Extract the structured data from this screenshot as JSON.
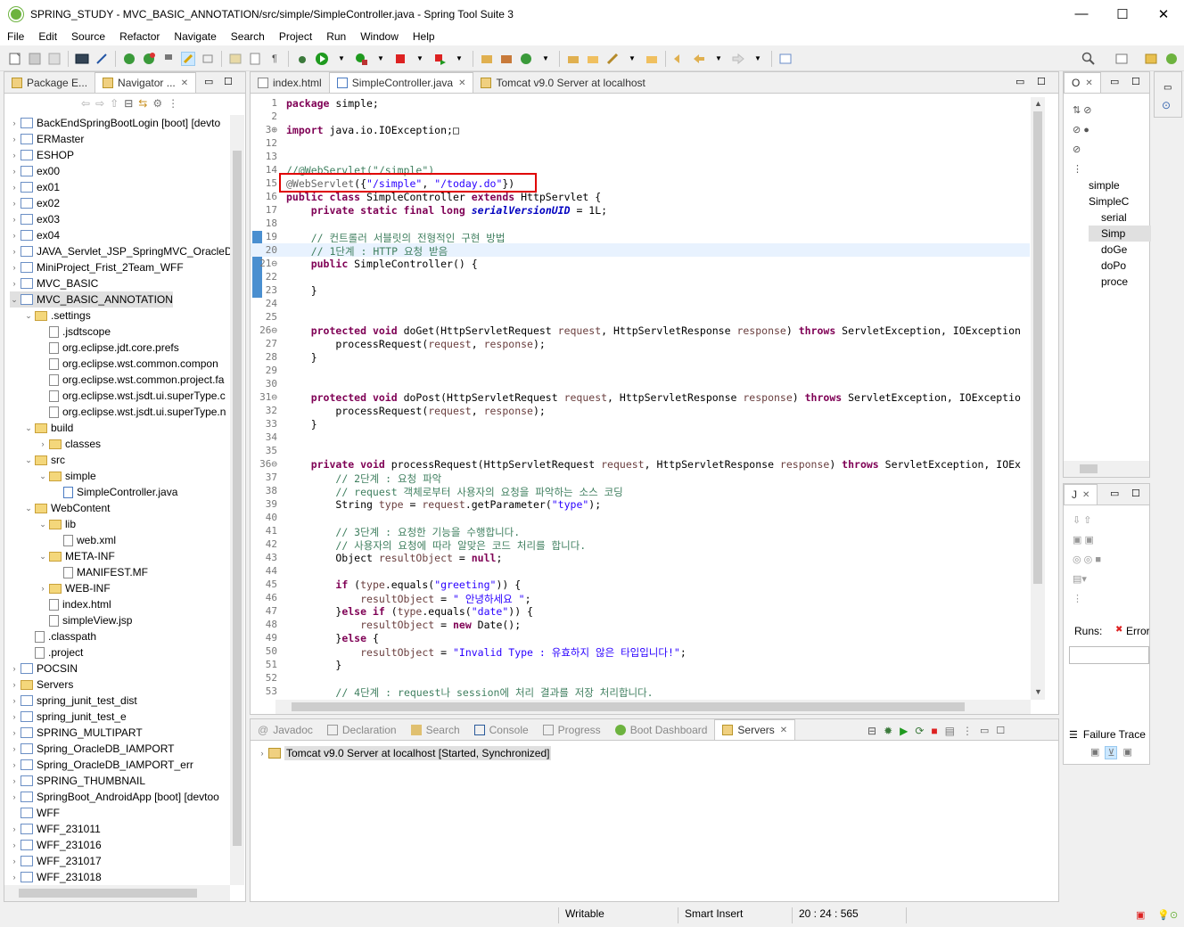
{
  "window": {
    "title": "SPRING_STUDY - MVC_BASIC_ANNOTATION/src/simple/SimpleController.java - Spring Tool Suite 3",
    "minimize": "—",
    "maximize": "☐",
    "close": "✕"
  },
  "menu": [
    "File",
    "Edit",
    "Source",
    "Refactor",
    "Navigate",
    "Search",
    "Project",
    "Run",
    "Window",
    "Help"
  ],
  "explorer": {
    "tabs": [
      "Package E...",
      "Navigator ..."
    ],
    "items": [
      {
        "label": "BackEndSpringBootLogin [boot] [devto",
        "type": "proj",
        "level": 0,
        "open": false
      },
      {
        "label": "ERMaster",
        "type": "proj",
        "level": 0,
        "open": false
      },
      {
        "label": "ESHOP",
        "type": "proj",
        "level": 0,
        "open": false
      },
      {
        "label": "ex00",
        "type": "proj",
        "level": 0,
        "open": false
      },
      {
        "label": "ex01",
        "type": "proj",
        "level": 0,
        "open": false
      },
      {
        "label": "ex02",
        "type": "proj",
        "level": 0,
        "open": false
      },
      {
        "label": "ex03",
        "type": "proj",
        "level": 0,
        "open": false
      },
      {
        "label": "ex04",
        "type": "proj",
        "level": 0,
        "open": false
      },
      {
        "label": "JAVA_Servlet_JSP_SpringMVC_OracleDB",
        "type": "proj",
        "level": 0,
        "open": false
      },
      {
        "label": "MiniProject_Frist_2Team_WFF",
        "type": "proj",
        "level": 0,
        "open": false
      },
      {
        "label": "MVC_BASIC",
        "type": "proj",
        "level": 0,
        "open": false
      },
      {
        "label": "MVC_BASIC_ANNOTATION",
        "type": "proj",
        "level": 0,
        "open": true,
        "selected": true
      },
      {
        "label": ".settings",
        "type": "folder",
        "level": 1,
        "open": true
      },
      {
        "label": ".jsdtscope",
        "type": "file",
        "level": 2
      },
      {
        "label": "org.eclipse.jdt.core.prefs",
        "type": "file",
        "level": 2
      },
      {
        "label": "org.eclipse.wst.common.compon",
        "type": "file",
        "level": 2
      },
      {
        "label": "org.eclipse.wst.common.project.fa",
        "type": "file",
        "level": 2
      },
      {
        "label": "org.eclipse.wst.jsdt.ui.superType.c",
        "type": "file",
        "level": 2
      },
      {
        "label": "org.eclipse.wst.jsdt.ui.superType.n",
        "type": "file",
        "level": 2
      },
      {
        "label": "build",
        "type": "folder",
        "level": 1,
        "open": true
      },
      {
        "label": "classes",
        "type": "folder",
        "level": 2,
        "open": false
      },
      {
        "label": "src",
        "type": "folder",
        "level": 1,
        "open": true
      },
      {
        "label": "simple",
        "type": "folder",
        "level": 2,
        "open": true
      },
      {
        "label": "SimpleController.java",
        "type": "java",
        "level": 3
      },
      {
        "label": "WebContent",
        "type": "folder",
        "level": 1,
        "open": true
      },
      {
        "label": "lib",
        "type": "folder",
        "level": 2,
        "open": true
      },
      {
        "label": "web.xml",
        "type": "file",
        "level": 3
      },
      {
        "label": "META-INF",
        "type": "folder",
        "level": 2,
        "open": true
      },
      {
        "label": "MANIFEST.MF",
        "type": "file",
        "level": 3
      },
      {
        "label": "WEB-INF",
        "type": "folder",
        "level": 2,
        "open": false
      },
      {
        "label": "index.html",
        "type": "file",
        "level": 2
      },
      {
        "label": "simpleView.jsp",
        "type": "file",
        "level": 2
      },
      {
        "label": ".classpath",
        "type": "file",
        "level": 1
      },
      {
        "label": ".project",
        "type": "file",
        "level": 1
      },
      {
        "label": "POCSIN",
        "type": "proj",
        "level": 0,
        "open": false
      },
      {
        "label": "Servers",
        "type": "folder",
        "level": 0,
        "open": false
      },
      {
        "label": "spring_junit_test_dist",
        "type": "proj",
        "level": 0,
        "open": false
      },
      {
        "label": "spring_junit_test_e",
        "type": "proj",
        "level": 0,
        "open": false
      },
      {
        "label": "SPRING_MULTIPART",
        "type": "proj",
        "level": 0,
        "open": false
      },
      {
        "label": "Spring_OracleDB_IAMPORT",
        "type": "proj",
        "level": 0,
        "open": false
      },
      {
        "label": "Spring_OracleDB_IAMPORT_err",
        "type": "proj",
        "level": 0,
        "open": false
      },
      {
        "label": "SPRING_THUMBNAIL",
        "type": "proj",
        "level": 0,
        "open": false
      },
      {
        "label": "SpringBoot_AndroidApp [boot] [devtoo",
        "type": "proj",
        "level": 0,
        "open": false
      },
      {
        "label": "WFF",
        "type": "proj",
        "level": 0,
        "open": null
      },
      {
        "label": "WFF_231011",
        "type": "proj",
        "level": 0,
        "open": false
      },
      {
        "label": "WFF_231016",
        "type": "proj",
        "level": 0,
        "open": false
      },
      {
        "label": "WFF_231017",
        "type": "proj",
        "level": 0,
        "open": false
      },
      {
        "label": "WFF_231018",
        "type": "proj",
        "level": 0,
        "open": false
      }
    ]
  },
  "editor": {
    "tabs": [
      "index.html",
      "SimpleController.java",
      "Tomcat v9.0 Server at localhost"
    ],
    "lines": [
      {
        "n": "1",
        "html": "<span class=\"kw\">package</span> simple;"
      },
      {
        "n": "2",
        "html": ""
      },
      {
        "n": "3⊕",
        "html": "<span class=\"kw\">import</span> java.io.IOException;□"
      },
      {
        "n": "12",
        "html": ""
      },
      {
        "n": "13",
        "html": ""
      },
      {
        "n": "14",
        "html": "<span class=\"cm\">//@WebServlet(\"/simple\")</span>"
      },
      {
        "n": "15",
        "html": "<span class=\"an\">@WebServlet</span>({<span class=\"st\">\"/simple\"</span>, <span class=\"st\">\"/today.do\"</span>})"
      },
      {
        "n": "16",
        "html": "<span class=\"kw\">public class</span> SimpleController <span class=\"kw\">extends</span> HttpServlet {"
      },
      {
        "n": "17",
        "html": "    <span class=\"kw\">private static final long</span> <span class=\"fld\">serialVersionUID</span> = 1L;"
      },
      {
        "n": "18",
        "html": ""
      },
      {
        "n": "19",
        "html": "    <span class=\"cm\">// 컨트롤러 서블릿의 전형적인 구현 방법</span>"
      },
      {
        "n": "20",
        "html": "    <span class=\"cm\">// 1단계 : HTTP 요청 받음</span>"
      },
      {
        "n": "21⊖",
        "html": "    <span class=\"kw\">public</span> SimpleController() {"
      },
      {
        "n": "22",
        "html": ""
      },
      {
        "n": "23",
        "html": "    }"
      },
      {
        "n": "24",
        "html": ""
      },
      {
        "n": "25",
        "html": ""
      },
      {
        "n": "26⊖",
        "html": "    <span class=\"kw\">protected void</span> doGet(HttpServletRequest <span class=\"pm\">request</span>, HttpServletResponse <span class=\"pm\">response</span>) <span class=\"kw\">throws</span> ServletException, IOException"
      },
      {
        "n": "27",
        "html": "        processRequest(<span class=\"pm\">request</span>, <span class=\"pm\">response</span>);"
      },
      {
        "n": "28",
        "html": "    }"
      },
      {
        "n": "29",
        "html": ""
      },
      {
        "n": "30",
        "html": ""
      },
      {
        "n": "31⊖",
        "html": "    <span class=\"kw\">protected void</span> doPost(HttpServletRequest <span class=\"pm\">request</span>, HttpServletResponse <span class=\"pm\">response</span>) <span class=\"kw\">throws</span> ServletException, IOExceptio"
      },
      {
        "n": "32",
        "html": "        processRequest(<span class=\"pm\">request</span>, <span class=\"pm\">response</span>);"
      },
      {
        "n": "33",
        "html": "    }"
      },
      {
        "n": "34",
        "html": ""
      },
      {
        "n": "35",
        "html": ""
      },
      {
        "n": "36⊖",
        "html": "    <span class=\"kw\">private void</span> processRequest(HttpServletRequest <span class=\"pm\">request</span>, HttpServletResponse <span class=\"pm\">response</span>) <span class=\"kw\">throws</span> ServletException, IOEx"
      },
      {
        "n": "37",
        "html": "        <span class=\"cm\">// 2단계 : 요청 파악</span>"
      },
      {
        "n": "38",
        "html": "        <span class=\"cm\">// request 객체로부터 사용자의 요청을 파악하는 소스 코딩</span>"
      },
      {
        "n": "39",
        "html": "        String <span class=\"pm\">type</span> = <span class=\"pm\">request</span>.getParameter(<span class=\"st\">\"type\"</span>);"
      },
      {
        "n": "40",
        "html": ""
      },
      {
        "n": "41",
        "html": "        <span class=\"cm\">// 3단계 : 요청한 기능을 수행합니다.</span>"
      },
      {
        "n": "42",
        "html": "        <span class=\"cm\">// 사용자의 요청에 따라 알맞은 코드 처리를 합니다.</span>"
      },
      {
        "n": "43",
        "html": "        Object <span class=\"pm\">resultObject</span> = <span class=\"kw\">null</span>;"
      },
      {
        "n": "44",
        "html": ""
      },
      {
        "n": "45",
        "html": "        <span class=\"kw\">if</span> (<span class=\"pm\">type</span>.equals(<span class=\"st\">\"greeting\"</span>)) {"
      },
      {
        "n": "46",
        "html": "            <span class=\"pm\">resultObject</span> = <span class=\"st\">\" 안녕하세요 \"</span>;"
      },
      {
        "n": "47",
        "html": "        }<span class=\"kw\">else if</span> (<span class=\"pm\">type</span>.equals(<span class=\"st\">\"date\"</span>)) {"
      },
      {
        "n": "48",
        "html": "            <span class=\"pm\">resultObject</span> = <span class=\"kw\">new</span> Date();"
      },
      {
        "n": "49",
        "html": "        }<span class=\"kw\">else</span> {"
      },
      {
        "n": "50",
        "html": "            <span class=\"pm\">resultObject</span> = <span class=\"st\">\"Invalid Type : 유효하지 않은 타입입니다!\"</span>;"
      },
      {
        "n": "51",
        "html": "        }"
      },
      {
        "n": "52",
        "html": ""
      },
      {
        "n": "53",
        "html": "        <span class=\"cm\">// 4단계 : request나 session에 처리 결과를 저장 처리합니다.</span>"
      }
    ]
  },
  "outline": {
    "tab": "O",
    "items": [
      "simple",
      "SimpleC",
      "serial",
      "Simp",
      "doGe",
      "doPo",
      "proce"
    ]
  },
  "junit": {
    "tab": "J",
    "runs_label": "Runs:",
    "error_label": "Error",
    "failure_trace": "Failure Trace"
  },
  "bottom": {
    "tabs": [
      "Javadoc",
      "Declaration",
      "Search",
      "Console",
      "Progress",
      "Boot Dashboard",
      "Servers"
    ],
    "server_entry": "Tomcat v9.0 Server at localhost  [Started, Synchronized]"
  },
  "status": {
    "writable": "Writable",
    "insert_mode": "Smart Insert",
    "position": "20 : 24 : 565"
  },
  "colors": {
    "highlight_box": "#e00000",
    "selection": "#cce8ff",
    "current_line": "#e8f2fe"
  }
}
